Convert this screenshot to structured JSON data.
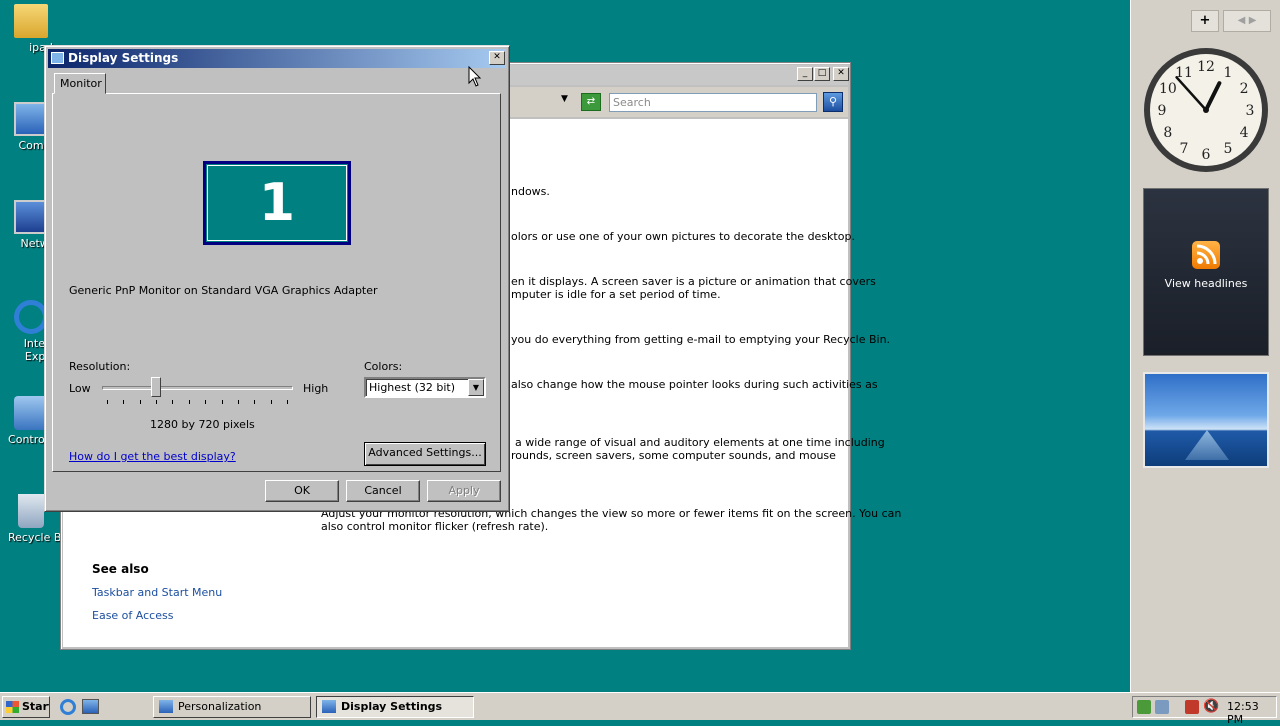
{
  "desktop": {
    "icons": [
      {
        "label": "ipad"
      },
      {
        "label": "Compu"
      },
      {
        "label": "Netwo"
      },
      {
        "label": "Intern"
      },
      {
        "label": "Explo"
      },
      {
        "label": "Control P"
      },
      {
        "label": "Recycle Bi"
      }
    ]
  },
  "personalization_window": {
    "search_placeholder": "Search",
    "paragraphs": [
      "ndows.",
      "olors or use one of your own pictures to decorate the desktop.",
      "en it displays. A screen saver is a picture or animation that covers",
      "mputer is idle for a set period of time.",
      "you do everything from getting e-mail to emptying your Recycle Bin.",
      "also change how the mouse pointer looks during such activities as",
      "a wide range of visual and auditory elements at one time including",
      "rounds, screen savers, some computer sounds, and mouse",
      "Adjust your monitor resolution, which changes the view so more or fewer items fit on the screen. You can",
      "also control monitor flicker (refresh rate)."
    ],
    "see_also": {
      "heading": "See also",
      "links": [
        "Taskbar and Start Menu",
        "Ease of Access"
      ]
    }
  },
  "dialog": {
    "title": "Display Settings",
    "tab": "Monitor",
    "monitor_number": "1",
    "monitor_name": "Generic PnP Monitor on Standard VGA Graphics Adapter",
    "resolution": {
      "label": "Resolution:",
      "low": "Low",
      "high": "High",
      "value_text": "1280 by 720 pixels",
      "slider_fraction": 0.27
    },
    "colors": {
      "label": "Colors:",
      "selected": "Highest (32 bit)"
    },
    "help_link": "How do I get the best display?",
    "advanced_button": "Advanced Settings...",
    "ok_button": "OK",
    "cancel_button": "Cancel",
    "apply_button": "Apply",
    "close_glyph": "✕"
  },
  "sidebar": {
    "add_button": "+",
    "rss_label": "View headlines",
    "clock": {
      "hour": 12,
      "minute": 53
    }
  },
  "taskbar": {
    "start_label": "Start",
    "tasks": [
      {
        "label": "Personalization"
      },
      {
        "label": "Display Settings"
      }
    ],
    "time": "12:53 PM"
  }
}
